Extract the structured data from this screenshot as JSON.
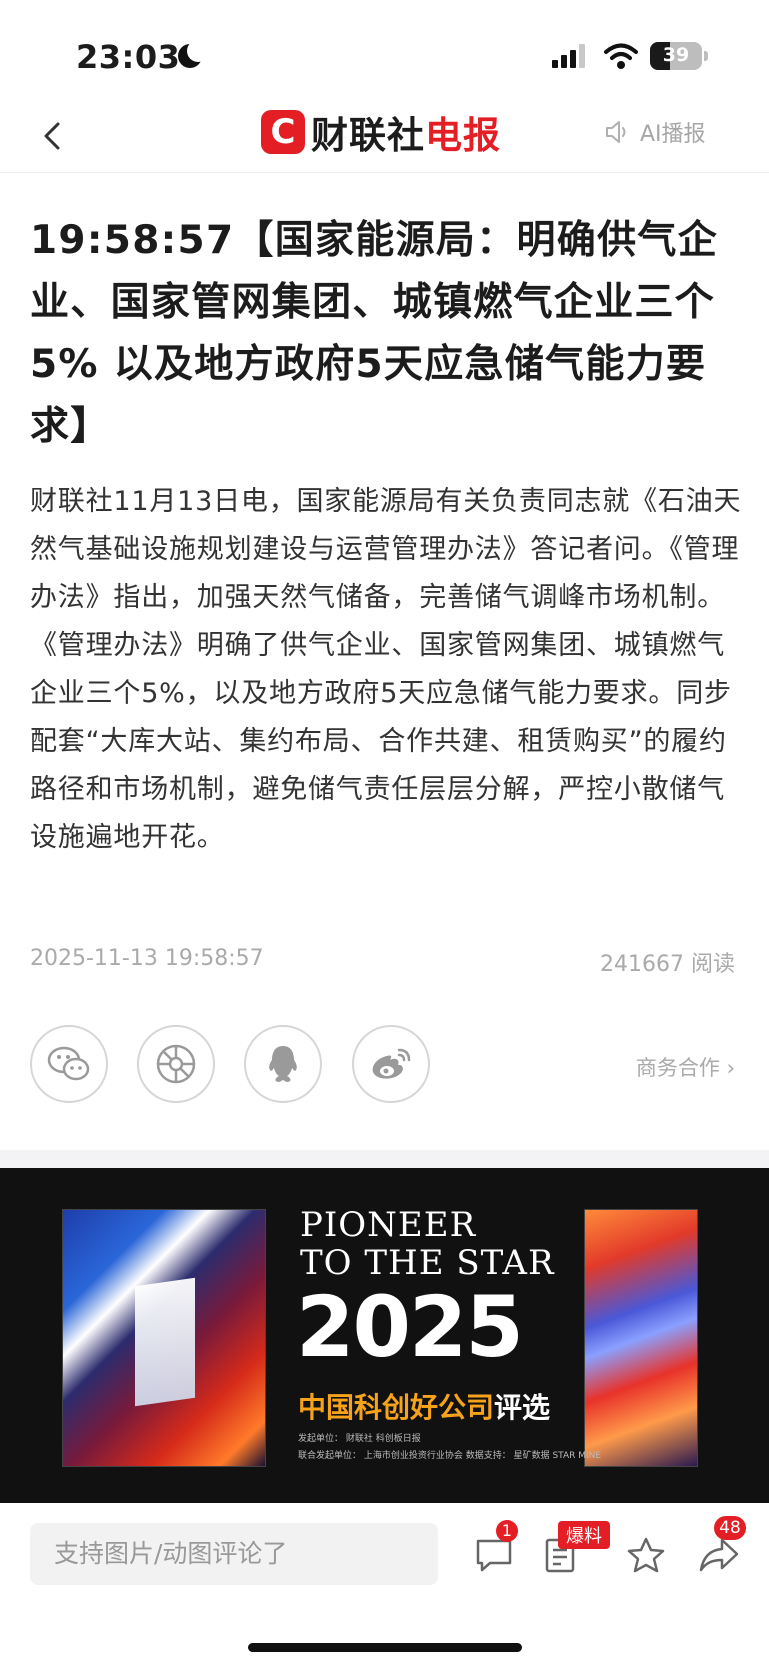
{
  "status_bar": {
    "time": "23:03",
    "battery": "39",
    "battery_level": 0.39
  },
  "nav": {
    "logo_c": "C",
    "logo_name": "财联社",
    "logo_suffix": "电报",
    "ai_label": "AI播报"
  },
  "article": {
    "title": "19:58:57【国家能源局：明确供气企业、国家管网集团、城镇燃气企业三个5% 以及地方政府5天应急储气能力要求】",
    "body": "财联社11月13日电，国家能源局有关负责同志就《石油天然气基础设施规划建设与运营管理办法》答记者问。《管理办法》指出，加强天然气储备，完善储气调峰市场机制。《管理办法》明确了供气企业、国家管网集团、城镇燃气企业三个5%，以及地方政府5天应急储气能力要求。同步配套“大库大站、集约布局、合作共建、租赁购买”的履约路径和市场机制，避免储气责任层层分解，严控小散储气设施遍地开花。",
    "date": "2025-11-13 19:58:57",
    "reads": "241667 阅读"
  },
  "share": {
    "icons": [
      "wechat-icon",
      "moments-icon",
      "qq-icon",
      "weibo-icon"
    ],
    "business": "商务合作 ›"
  },
  "ad": {
    "line1": "PIONEER",
    "line2": "TO THE STAR",
    "year": "2025",
    "selection_main": "中国科创好公司",
    "selection_suffix": "评选",
    "fine1": "发起单位：  财联社    科创板日报",
    "fine2": "联合发起单位：  上海市创业投资行业协会      数据支持：  星矿数据 STAR MINE"
  },
  "bottom_bar": {
    "comment_placeholder": "支持图片/动图评论了",
    "comment_badge": "1",
    "baoliao": "爆料",
    "share_count": "48"
  }
}
